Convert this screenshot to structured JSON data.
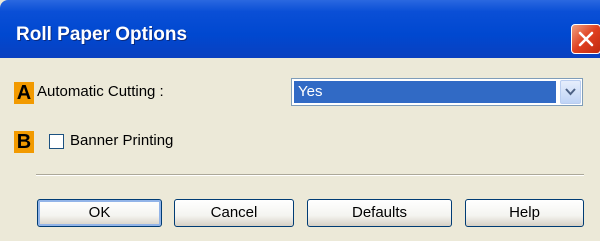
{
  "window": {
    "title": "Roll Paper Options",
    "close_icon": "close-icon"
  },
  "options": {
    "automatic_cutting": {
      "badge": "A",
      "label": "Automatic Cutting :",
      "selected_value": "Yes"
    },
    "banner_printing": {
      "badge": "B",
      "label": "Banner Printing",
      "checked": false
    }
  },
  "buttons": {
    "ok": "OK",
    "cancel": "Cancel",
    "defaults": "Defaults",
    "help": "Help"
  },
  "colors": {
    "titlebar": "#0048d0",
    "badge": "#f29a00",
    "selection": "#316ac5",
    "close_button": "#e04020"
  }
}
